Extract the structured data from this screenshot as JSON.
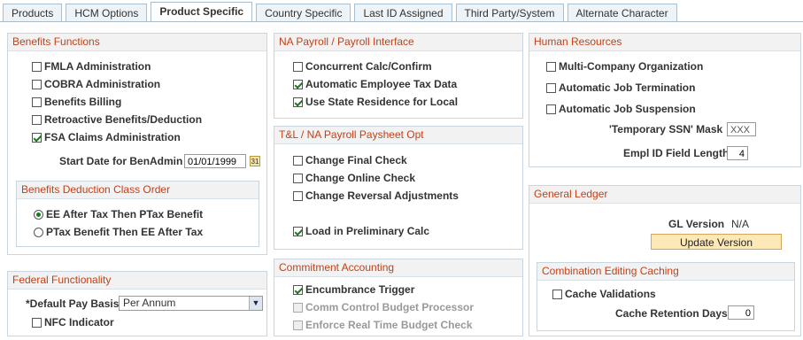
{
  "tabs": [
    "Products",
    "HCM Options",
    "Product Specific",
    "Country Specific",
    "Last ID Assigned",
    "Third Party/System",
    "Alternate Character"
  ],
  "benefits": {
    "title": "Benefits Functions",
    "items": [
      "FMLA Administration",
      "COBRA Administration",
      "Benefits Billing",
      "Retroactive Benefits/Deduction",
      "FSA Claims Administration"
    ],
    "start_date_label": "Start Date for BenAdmin",
    "start_date_value": "01/01/1999",
    "calendar_glyph": "31"
  },
  "deduction": {
    "title": "Benefits Deduction Class Order",
    "options": [
      "EE After Tax Then PTax Benefit",
      "PTax Benefit Then EE After Tax"
    ]
  },
  "federal": {
    "title": "Federal Functionality",
    "pay_basis_label": "*Default Pay Basis",
    "pay_basis_value": "Per Annum",
    "nfc_label": "NFC Indicator"
  },
  "na_payroll": {
    "title": "NA Payroll / Payroll Interface",
    "items": [
      "Concurrent Calc/Confirm",
      "Automatic Employee Tax Data",
      "Use State Residence for Local"
    ]
  },
  "tl": {
    "title": "T&L / NA Payroll Paysheet Opt",
    "items": [
      "Change Final Check",
      "Change Online Check",
      "Change Reversal Adjustments"
    ],
    "load_label": "Load in Preliminary Calc"
  },
  "commitment": {
    "title": "Commitment Accounting",
    "items": [
      "Encumbrance Trigger",
      "Comm Control Budget Processor",
      "Enforce Real Time Budget Check"
    ]
  },
  "hr": {
    "title": "Human Resources",
    "items": [
      "Multi-Company Organization",
      "Automatic Job Termination",
      "Automatic Job Suspension"
    ],
    "ssn_label": "'Temporary SSN' Mask",
    "ssn_value": "XXX",
    "emplid_label": "Empl ID Field Length",
    "emplid_value": "4"
  },
  "gl": {
    "title": "General Ledger",
    "version_label": "GL Version",
    "version_value": "N/A",
    "update_button": "Update Version"
  },
  "caching": {
    "title": "Combination Editing Caching",
    "cache_label": "Cache Validations",
    "retention_label": "Cache Retention Days",
    "retention_value": "0"
  }
}
